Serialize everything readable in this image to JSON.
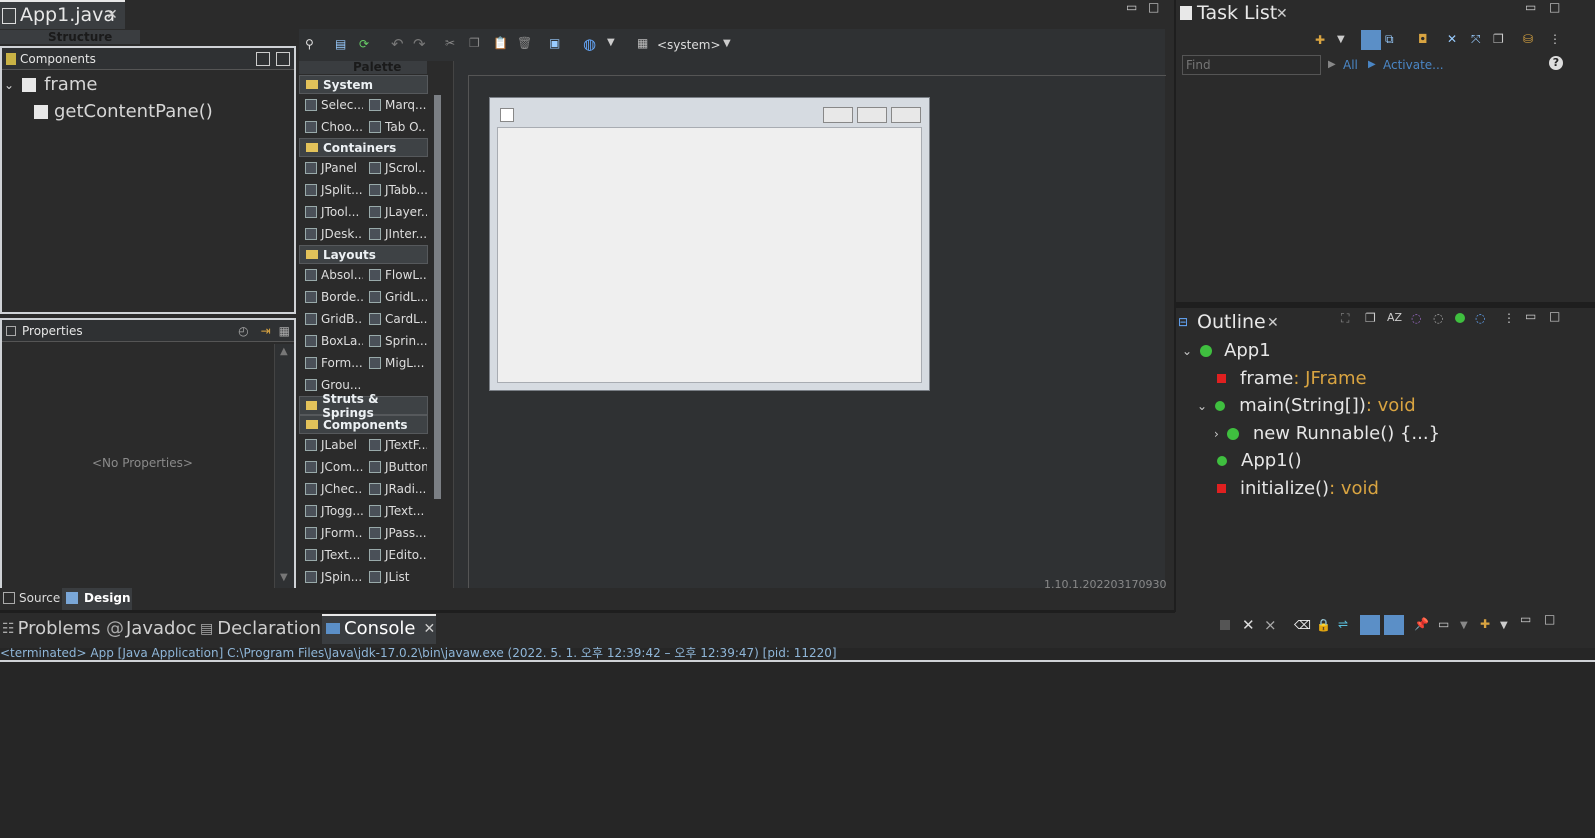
{
  "editor_tab": {
    "title": "App1.java"
  },
  "structure": {
    "label": "Structure"
  },
  "components_pane": {
    "title": "Components",
    "tree": [
      {
        "label": "frame"
      },
      {
        "label": "getContentPane()"
      }
    ]
  },
  "properties_pane": {
    "title": "Properties",
    "empty_text": "<No Properties>"
  },
  "palette": {
    "label": "Palette",
    "categories": [
      {
        "name": "System",
        "items": [
          "Selec...",
          "Marq...",
          "Choo...",
          "Tab O..."
        ]
      },
      {
        "name": "Containers",
        "items": [
          "JPanel",
          "JScrol...",
          "JSplit...",
          "JTabb...",
          "JTool...",
          "JLayer...",
          "JDesk...",
          "JInter..."
        ]
      },
      {
        "name": "Layouts",
        "items": [
          "Absol...",
          "FlowL...",
          "Borde...",
          "GridL...",
          "GridB...",
          "CardL...",
          "BoxLa...",
          "Sprin...",
          "Form...",
          "MigL...",
          "Grou..."
        ]
      },
      {
        "name": "Struts & Springs",
        "items": []
      },
      {
        "name": "Components",
        "items": [
          "JLabel",
          "JTextF...",
          "JCom...",
          "JButton",
          "JChec...",
          "JRadi...",
          "JTogg...",
          "JText...",
          "JForm...",
          "JPass...",
          "JText...",
          "JEdito...",
          "JSpin...",
          "JList"
        ]
      }
    ]
  },
  "design_toolbar": {
    "lookandfeel": "<system>"
  },
  "canvas": {
    "version_text": "1.10.1.202203170930"
  },
  "bottom_tabs": {
    "source": "Source",
    "design": "Design"
  },
  "task_list": {
    "title": "Task List",
    "find_placeholder": "Find",
    "all_label": "All",
    "activate_label": "Activate..."
  },
  "outline": {
    "title": "Outline",
    "items": [
      {
        "name": "App1",
        "type": ""
      },
      {
        "name": "frame",
        "type": " : JFrame"
      },
      {
        "name": "main(String[])",
        "type": " : void"
      },
      {
        "name": "new Runnable() {...}",
        "type": ""
      },
      {
        "name": "App1()",
        "type": ""
      },
      {
        "name": "initialize()",
        "type": " : void"
      }
    ]
  },
  "console": {
    "tabs": [
      "Problems",
      "Javadoc",
      "Declaration",
      "Console"
    ],
    "status_line": "<terminated> App [Java Application] C:\\Program Files\\Java\\jdk-17.0.2\\bin\\javaw.exe  (2022. 5. 1. 오후 12:39:42 – 오후 12:39:47) [pid: 11220]"
  }
}
